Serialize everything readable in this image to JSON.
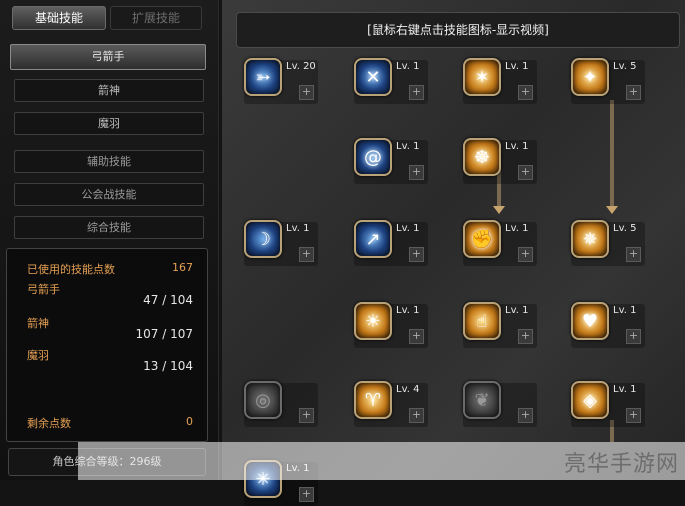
{
  "tabs": [
    {
      "label": "基础技能",
      "active": true
    },
    {
      "label": "扩展技能",
      "active": false
    }
  ],
  "categories": {
    "main": "弓箭手",
    "items": [
      "箭神",
      "魔羽"
    ],
    "support": "辅助技能",
    "guild": "公会战技能",
    "general": "综合技能"
  },
  "stats": {
    "used_label": "已使用的技能点数",
    "used_value": "167",
    "class1_label": "弓箭手",
    "class1_value": "47 / 104",
    "class2_label": "箭神",
    "class2_value": "107 / 107",
    "class3_label": "魔羽",
    "class3_value": "13 / 104",
    "remaining_label": "剩余点数",
    "remaining_value": "0"
  },
  "character_level": "角色综合等级：296级",
  "banner": "[鼠标右键点击技能图标-显示视频]",
  "skills": [
    {
      "name": "skill-r1c1",
      "level": "Lv. 20",
      "icon": "triple-arrow-icon",
      "style": "blue"
    },
    {
      "name": "skill-r1c2",
      "level": "Lv. 1",
      "icon": "cross-arrow-icon",
      "style": "blue"
    },
    {
      "name": "skill-r1c3",
      "level": "Lv. 1",
      "icon": "eagle-icon",
      "style": "gold"
    },
    {
      "name": "skill-r1c4",
      "level": "Lv. 5",
      "icon": "strike-icon",
      "style": "gold"
    },
    {
      "name": "skill-r2c2",
      "level": "Lv. 1",
      "icon": "swirl-icon",
      "style": "blue"
    },
    {
      "name": "skill-r2c3",
      "level": "Lv. 1",
      "icon": "boot-icon",
      "style": "gold"
    },
    {
      "name": "skill-r3c1",
      "level": "Lv. 1",
      "icon": "bow-icon",
      "style": "blue"
    },
    {
      "name": "skill-r3c2",
      "level": "Lv. 1",
      "icon": "arrow-dive-icon",
      "style": "blue"
    },
    {
      "name": "skill-r3c3",
      "level": "Lv. 1",
      "icon": "fist-icon",
      "style": "gold"
    },
    {
      "name": "skill-r3c4",
      "level": "Lv. 5",
      "icon": "burst-icon",
      "style": "gold"
    },
    {
      "name": "skill-r4c2",
      "level": "Lv. 1",
      "icon": "radiant-figure-icon",
      "style": "gold"
    },
    {
      "name": "skill-r4c3",
      "level": "Lv. 1",
      "icon": "thumb-up-icon",
      "style": "gold"
    },
    {
      "name": "skill-r4c4",
      "level": "Lv. 1",
      "icon": "air-heart-icon",
      "style": "gold"
    },
    {
      "name": "skill-r5c1",
      "level": "",
      "icon": "ring-icon",
      "style": "gray"
    },
    {
      "name": "skill-r5c2",
      "level": "Lv. 4",
      "icon": "rising-figure-icon",
      "style": "gold"
    },
    {
      "name": "skill-r5c3",
      "level": "",
      "icon": "winged-icon",
      "style": "gray"
    },
    {
      "name": "skill-r5c4",
      "level": "Lv. 1",
      "icon": "mp-shield-icon",
      "style": "gold"
    },
    {
      "name": "skill-r6c1",
      "level": "Lv. 1",
      "icon": "partial-icon",
      "style": "blue"
    }
  ],
  "watermark": "亮华手游网"
}
